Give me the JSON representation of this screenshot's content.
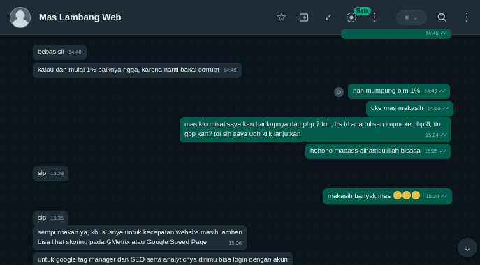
{
  "header": {
    "contact_name": "Mas Lambang Web",
    "beta_label": "Beta",
    "icons": [
      "star-icon",
      "forward-icon",
      "check-icon",
      "status-icon",
      "menu-icon",
      "video-call-icon",
      "search-icon",
      "kebab-icon"
    ]
  },
  "messages": [
    {
      "direction": "out",
      "text": "",
      "time": "14:46",
      "ticks": "✓✓"
    },
    {
      "direction": "in",
      "text": "bebas sii",
      "time": "14:48"
    },
    {
      "direction": "in",
      "text": "kalau dah mulai 1% baiknya ngga, karena nanti bakal corrupt",
      "time": "14:49"
    },
    {
      "direction": "out",
      "text": "nah mumpung blm 1%",
      "time": "14:49",
      "ticks": "✓✓"
    },
    {
      "direction": "out",
      "text": "oke mas makasih",
      "time": "14:50",
      "ticks": "✓✓"
    },
    {
      "direction": "out",
      "text_line1": "mas klo misal saya kan backupnya dari php 7 tuh, trs td ada tulisan impor ke php 8, itu",
      "text_line2": "gpp kan? tdi sih saya udh klik lanjutkan",
      "time": "15:24",
      "ticks": "✓✓"
    },
    {
      "direction": "out",
      "text": "hohoho maaass alhamdulillah bisaaa",
      "time": "15:25",
      "ticks": "✓✓"
    },
    {
      "direction": "in",
      "text": "sip",
      "time": "15:28"
    },
    {
      "direction": "out",
      "text": "makasih banyak mas",
      "time": "15:28",
      "ticks": "✓✓"
    },
    {
      "direction": "in",
      "text": "sip",
      "time": "15:35"
    },
    {
      "direction": "in",
      "text_line1": "sempurnakan ya, khususnya untuk kecepatan website masih lamban",
      "text_line2": "bisa lihat skoring pada GMetrix atau Google Speed Page",
      "time": "15:36"
    },
    {
      "direction": "in",
      "text": "untuk google tag manager dan SEO serta analyticnya dirimu bisa login dengan akun"
    }
  ],
  "colors": {
    "background": "#0b141a",
    "header": "#202c33",
    "incoming_bubble": "#202c33",
    "outgoing_bubble": "#005c4b",
    "read_ticks": "#53bdeb"
  }
}
